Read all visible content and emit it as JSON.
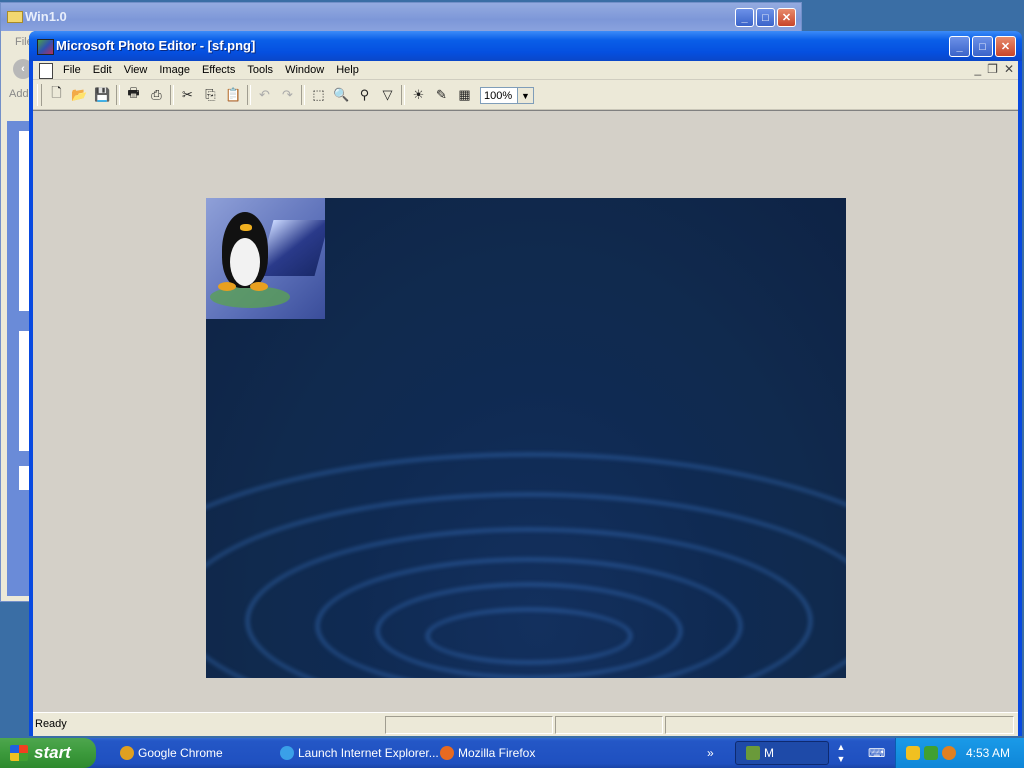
{
  "background_window": {
    "title": "Win1.0",
    "menu_partial": "File",
    "address_partial": "Addr"
  },
  "window": {
    "title": "Microsoft Photo Editor - [sf.png]",
    "buttons": {
      "minimize": "_",
      "maximize": "□",
      "close": "✕"
    }
  },
  "menu": {
    "items": [
      "File",
      "Edit",
      "View",
      "Image",
      "Effects",
      "Tools",
      "Window",
      "Help"
    ],
    "mdi": {
      "minimize": "_",
      "restore": "❐",
      "close": "✕"
    }
  },
  "toolbar": {
    "icons": {
      "new": "🗋",
      "open": "📂",
      "save": "💾",
      "print": "🖶",
      "scan": "⎙",
      "cut": "✂",
      "copy": "⎘",
      "paste": "📋",
      "undo": "↶",
      "redo": "↷",
      "select": "⬚",
      "zoom": "🔍",
      "smudge": "⚲",
      "sharpen": "▽",
      "balance": "☀",
      "paint": "✎",
      "effects": "▦"
    },
    "zoom_value": "100%",
    "zoom_arrow": "▼"
  },
  "status": {
    "text": "Ready",
    "panels": [
      "",
      "",
      ""
    ]
  },
  "taskbar": {
    "start_label": "start",
    "items": [
      {
        "label": "Google Chrome",
        "color": "#e0a020"
      },
      {
        "label": "Launch Internet Explorer...",
        "color": "#3aa0e8"
      },
      {
        "label": "Mozilla Firefox",
        "color": "#e86a20"
      },
      {
        "label": "M",
        "color": "#6a9a3a"
      }
    ],
    "overflow": "»",
    "clock": "4:53 AM"
  },
  "colors": {
    "xp_blue": "#0a5fe8",
    "canvas_bg": "#102a4e",
    "face": "#ece9d8"
  }
}
